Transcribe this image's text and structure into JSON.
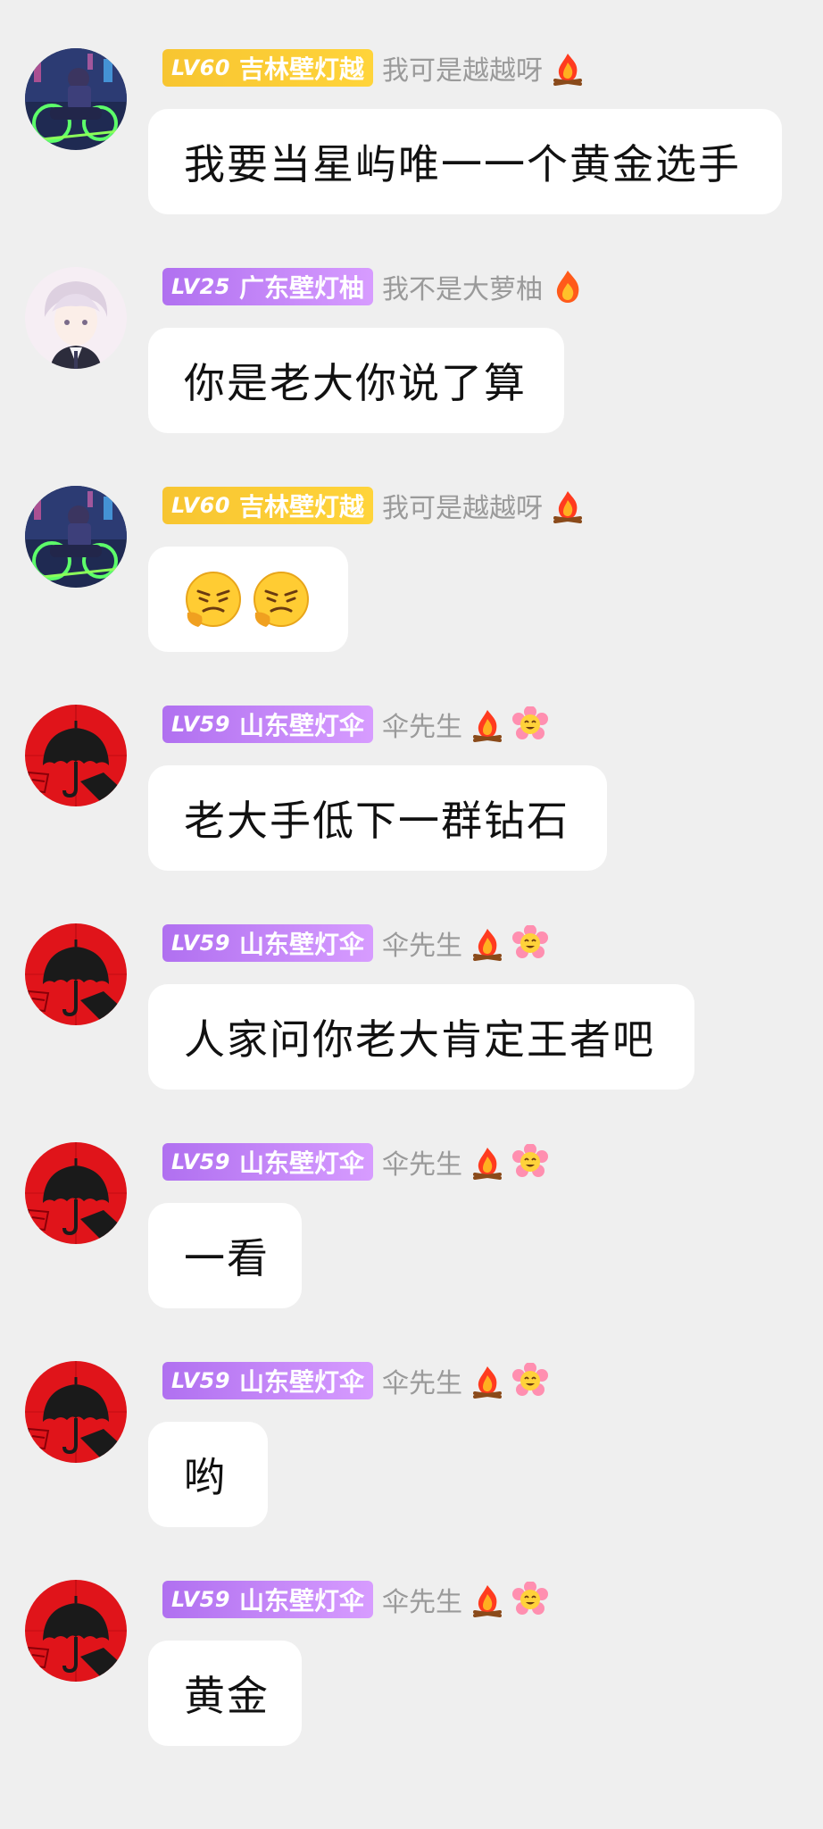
{
  "messages": [
    {
      "avatar": "cyberpunk-biker-avatar",
      "badge": {
        "level": "LV60",
        "title": "吉林壁灯越",
        "color": "#f7c531"
      },
      "nickname": "我可是越越呀",
      "icons": [
        "campfire-icon"
      ],
      "text": "我要当星屿唯一一个黄金选手"
    },
    {
      "avatar": "anime-boy-avatar",
      "badge": {
        "level": "LV25",
        "title": "广东壁灯柚",
        "color": "#b070f0"
      },
      "nickname": "我不是大萝柚",
      "icons": [
        "flame-icon"
      ],
      "text": "你是老大你说了算"
    },
    {
      "avatar": "cyberpunk-biker-avatar",
      "badge": {
        "level": "LV60",
        "title": "吉林壁灯越",
        "color": "#f7c531"
      },
      "nickname": "我可是越越呀",
      "icons": [
        "campfire-icon"
      ],
      "emojis": [
        "frowning-face-emoji",
        "frowning-face-emoji"
      ]
    },
    {
      "avatar": "umbrella-avatar",
      "badge": {
        "level": "LV59",
        "title": "山东壁灯伞",
        "color": "#b070f0"
      },
      "nickname": "伞先生",
      "icons": [
        "campfire-icon",
        "flower-face-icon"
      ],
      "text": "老大手低下一群钻石"
    },
    {
      "avatar": "umbrella-avatar",
      "badge": {
        "level": "LV59",
        "title": "山东壁灯伞",
        "color": "#b070f0"
      },
      "nickname": "伞先生",
      "icons": [
        "campfire-icon",
        "flower-face-icon"
      ],
      "text": "人家问你老大肯定王者吧"
    },
    {
      "avatar": "umbrella-avatar",
      "badge": {
        "level": "LV59",
        "title": "山东壁灯伞",
        "color": "#b070f0"
      },
      "nickname": "伞先生",
      "icons": [
        "campfire-icon",
        "flower-face-icon"
      ],
      "text": "一看"
    },
    {
      "avatar": "umbrella-avatar",
      "badge": {
        "level": "LV59",
        "title": "山东壁灯伞",
        "color": "#b070f0"
      },
      "nickname": "伞先生",
      "icons": [
        "campfire-icon",
        "flower-face-icon"
      ],
      "text": "哟"
    },
    {
      "avatar": "umbrella-avatar",
      "badge": {
        "level": "LV59",
        "title": "山东壁灯伞",
        "color": "#b070f0"
      },
      "nickname": "伞先生",
      "icons": [
        "campfire-icon",
        "flower-face-icon"
      ],
      "text": "黄金"
    }
  ]
}
